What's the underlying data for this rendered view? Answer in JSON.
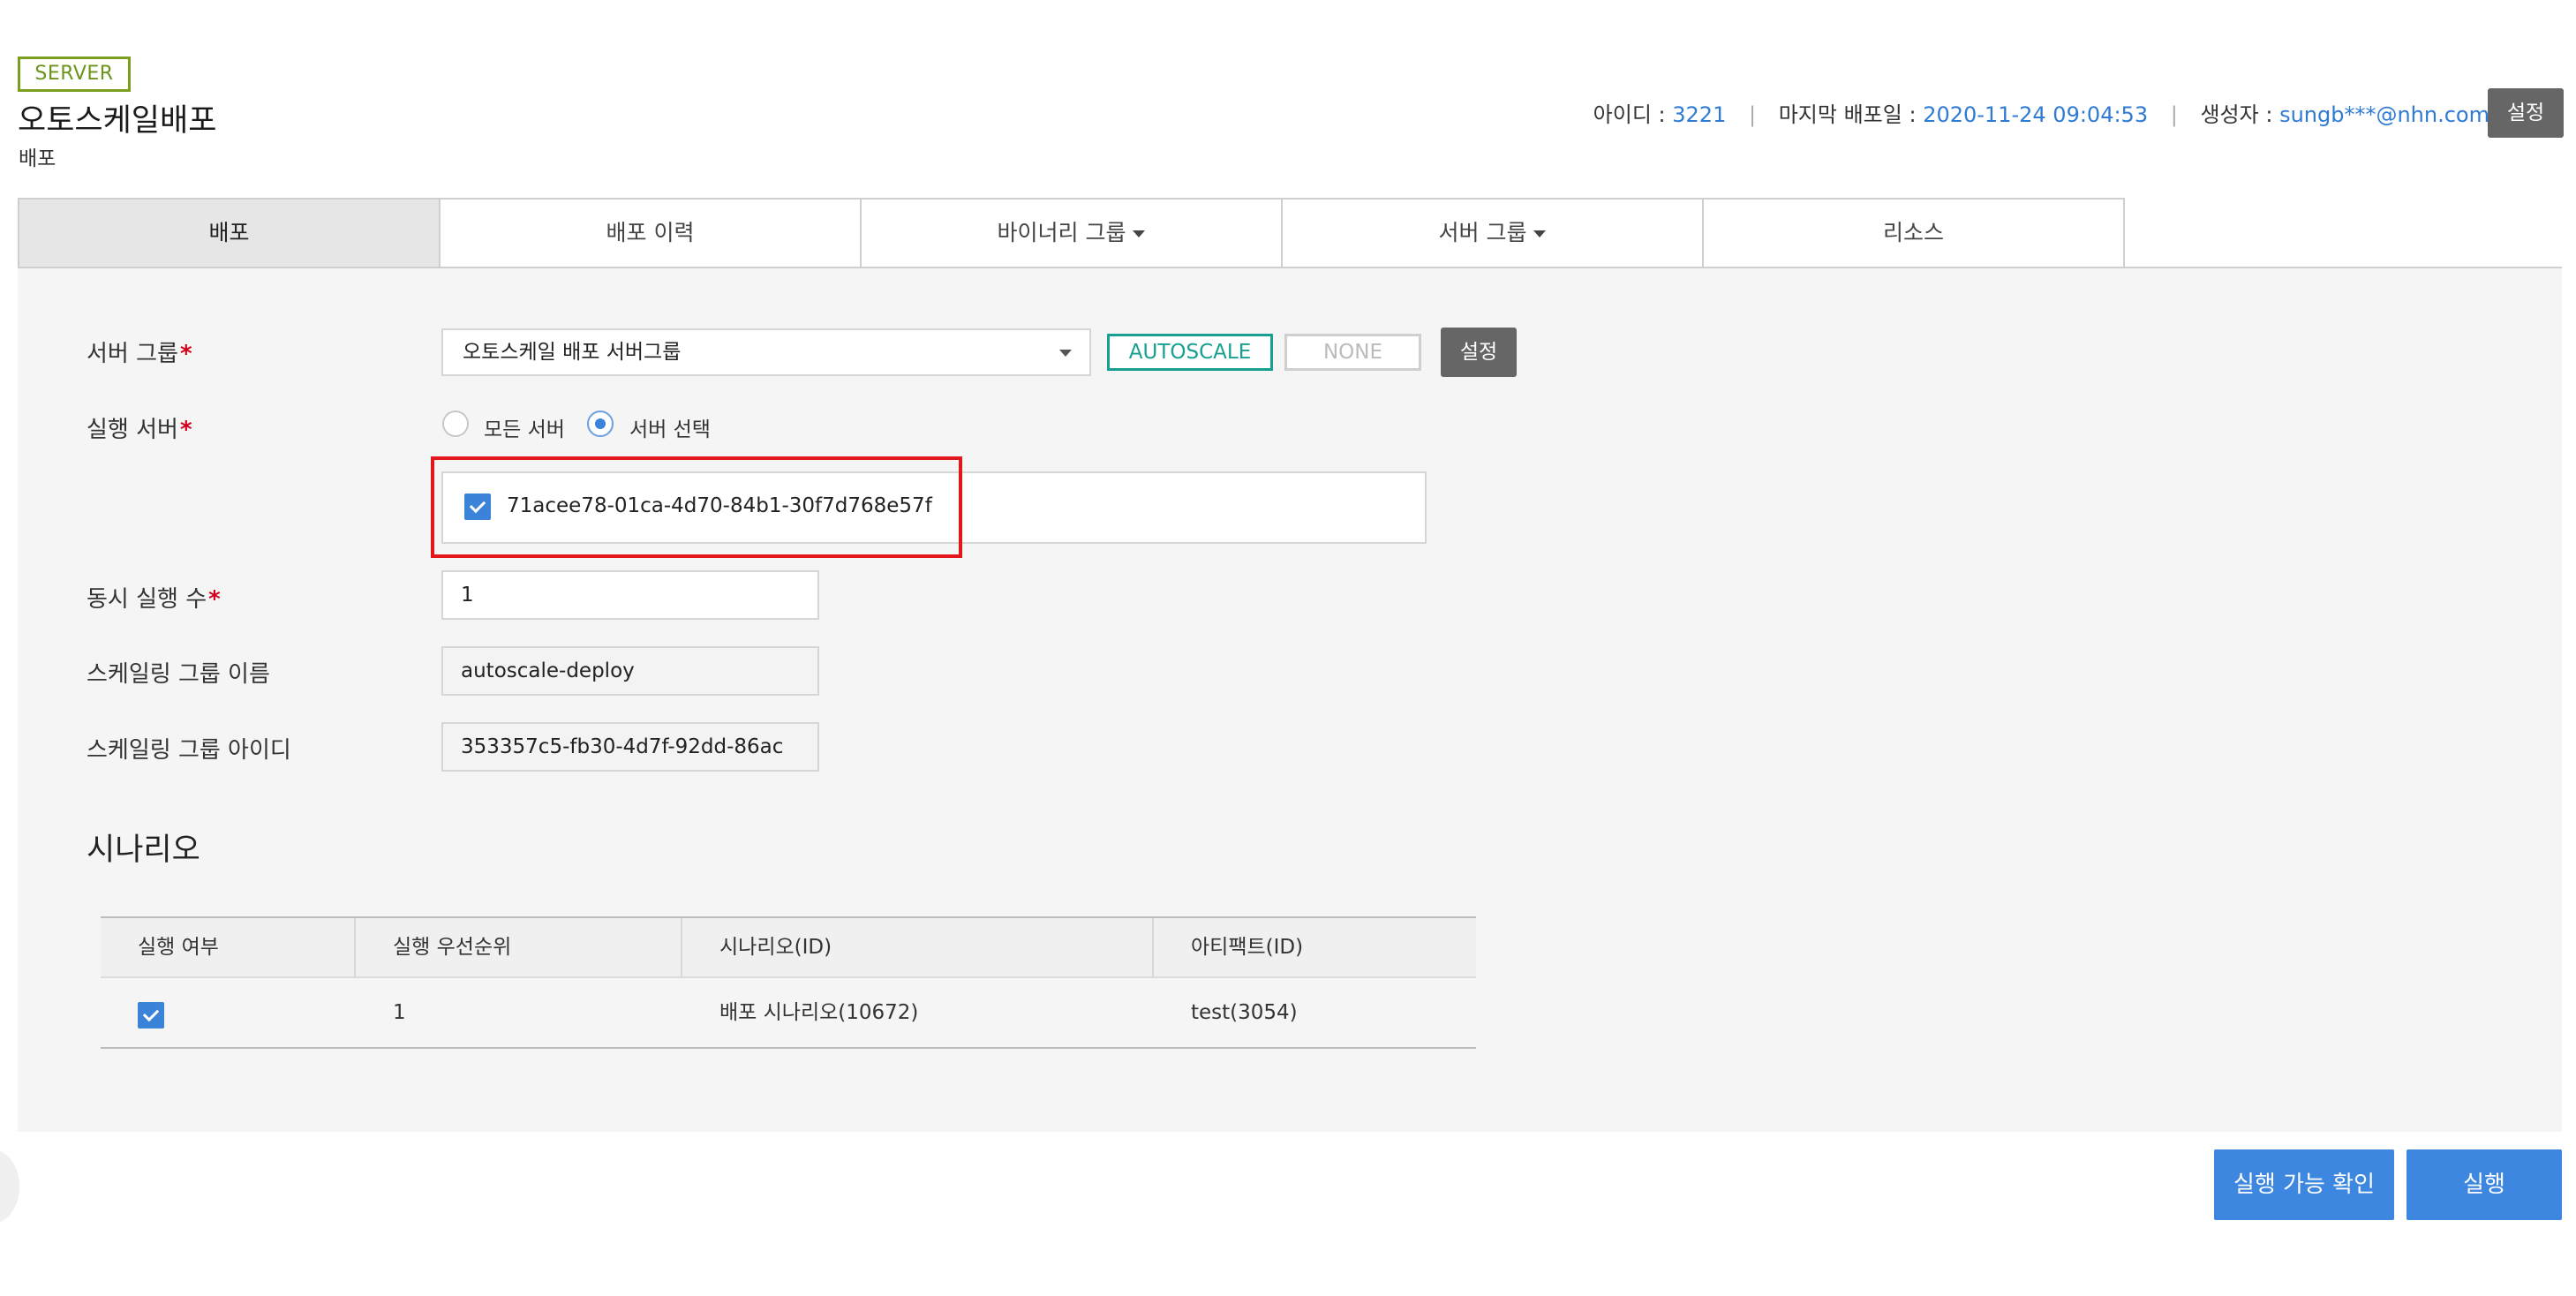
{
  "header": {
    "badge": "SERVER",
    "title": "오토스케일배포",
    "subtitle": "배포",
    "meta": {
      "id_label": "아이디 :",
      "id_value": "3221",
      "deploy_label": "마지막 배포일 :",
      "deploy_value": "2020-11-24 09:04:53",
      "creator_label": "생성자 :",
      "creator_value": "sungb***@nhn.com"
    },
    "settings_button": "설정"
  },
  "tabs": [
    {
      "label": "배포",
      "active": true
    },
    {
      "label": "배포 이력"
    },
    {
      "label": "바이너리 그룹",
      "dropdown": true
    },
    {
      "label": "서버 그룹",
      "dropdown": true
    },
    {
      "label": "리소스"
    }
  ],
  "form": {
    "server_group_label": "서버 그룹",
    "server_group_value": "오토스케일 배포 서버그룹",
    "tag_autoscale": "AUTOSCALE",
    "tag_none": "NONE",
    "set_button": "설정",
    "exec_server_label": "실행 서버",
    "radio_all": "모든 서버",
    "radio_select": "서버 선택",
    "selected_server": "71acee78-01ca-4d70-84b1-30f7d768e57f",
    "concurrency_label": "동시 실행 수",
    "concurrency_value": "1",
    "scaling_name_label": "스케일링 그룹 이름",
    "scaling_name_value": "autoscale-deploy",
    "scaling_id_label": "스케일링 그룹 아이디",
    "scaling_id_value": "353357c5-fb30-4d7f-92dd-86ac",
    "required_mark": "*"
  },
  "scenario": {
    "title": "시나리오",
    "columns": [
      "실행 여부",
      "실행 우선순위",
      "시나리오(ID)",
      "아티팩트(ID)"
    ],
    "rows": [
      {
        "checked": true,
        "priority": "1",
        "scenario": "배포 시나리오(10672)",
        "artifact": "test(3054)"
      }
    ]
  },
  "footer": {
    "check_button": "실행 가능 확인",
    "run_button": "실행"
  },
  "colors": {
    "accent_blue": "#3d87e0",
    "link_blue": "#2f7bd4",
    "autoscale_teal": "#17a091",
    "server_badge_green": "#7ba01e",
    "highlight_red": "#e3161b"
  }
}
